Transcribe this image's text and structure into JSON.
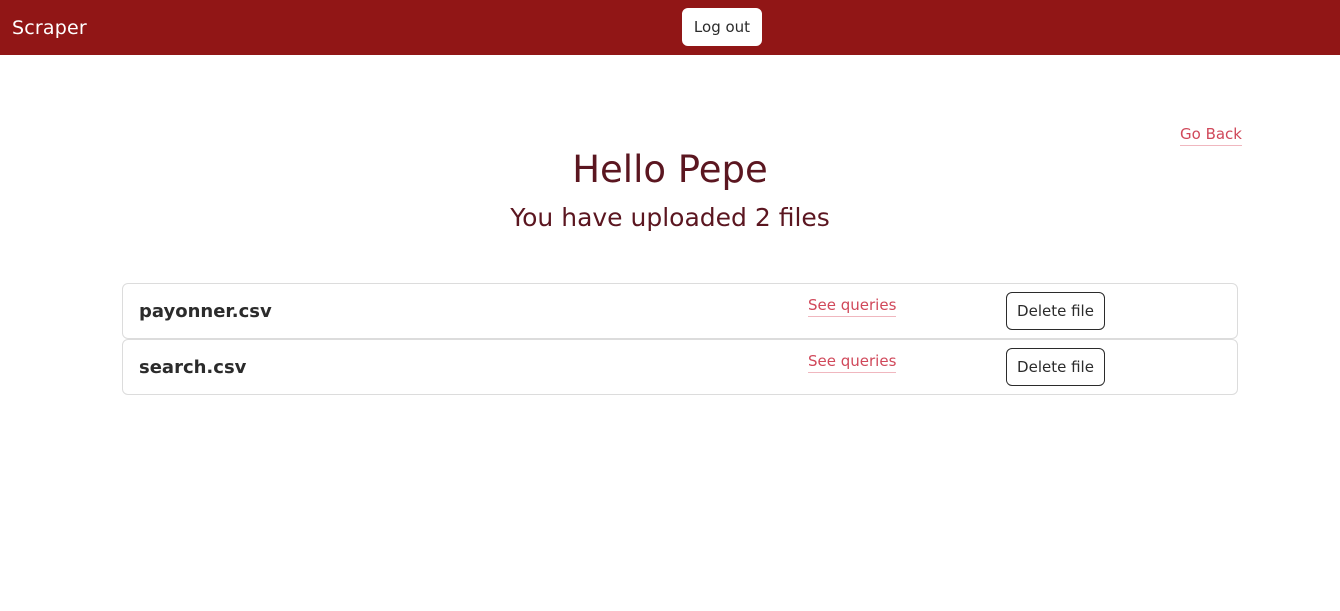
{
  "navbar": {
    "brand": "Scraper",
    "logout_label": "Log out",
    "background_color": "#911616"
  },
  "main": {
    "go_back_label": "Go Back",
    "greeting": "Hello Pepe",
    "subtitle": "You have uploaded 2 files",
    "files": [
      {
        "name": "payonner.csv",
        "see_queries_label": "See queries",
        "delete_label": "Delete file"
      },
      {
        "name": "search.csv",
        "see_queries_label": "See queries",
        "delete_label": "Delete file"
      }
    ]
  },
  "colors": {
    "accent": "#911616",
    "link": "#d0485a",
    "heading": "#5b1620"
  }
}
